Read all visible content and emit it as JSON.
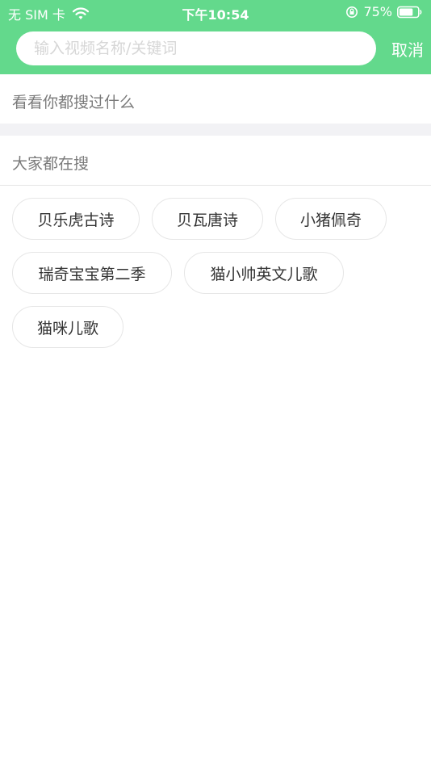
{
  "status_bar": {
    "carrier": "无 SIM 卡",
    "time": "下午10:54",
    "battery_percent": "75%",
    "battery_level": 0.75,
    "icons": [
      "wifi-icon",
      "rotation-lock-icon",
      "battery-icon"
    ]
  },
  "search": {
    "placeholder": "输入视频名称/关键词",
    "value": "",
    "cancel_label": "取消"
  },
  "history": {
    "title": "看看你都搜过什么"
  },
  "hot": {
    "title": "大家都在搜",
    "tags": [
      "贝乐虎古诗",
      "贝瓦唐诗",
      "小猪佩奇",
      "瑞奇宝宝第二季",
      "猫小帅英文儿歌",
      "猫咪儿歌"
    ]
  },
  "colors": {
    "brand_green": "#63d98c",
    "divider_gray": "#f2f2f5"
  }
}
